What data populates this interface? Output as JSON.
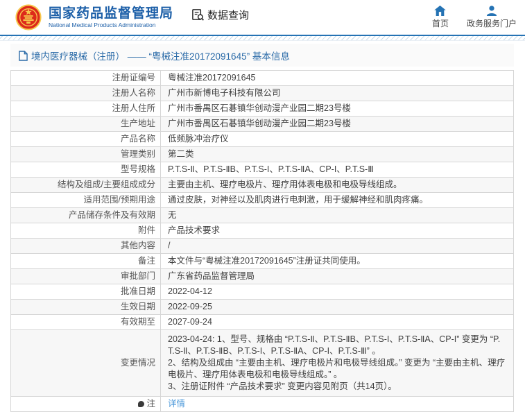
{
  "header": {
    "title": "国家药品监督管理局",
    "subtitle": "National Medical Products Administration",
    "data_query_label": "数据查询",
    "nav": [
      {
        "label": "首页",
        "icon": "home-icon"
      },
      {
        "label": "政务服务门户",
        "icon": "user-icon"
      }
    ]
  },
  "colors": {
    "brand_blue": "#1c5fa8",
    "icon_blue": "#2573b4",
    "link_blue": "#4a97d9",
    "emblem_red": "#dd2a1b",
    "emblem_gold": "#f7c84c",
    "stripe_gray": "#f7f7f7"
  },
  "breadcrumb": {
    "text": "境内医疗器械（注册） —— “粤械注准20172091645” 基本信息"
  },
  "table": {
    "rows": [
      {
        "label": "注册证编号",
        "value": "粤械注准20172091645"
      },
      {
        "label": "注册人名称",
        "value": "广州市新博电子科技有限公司"
      },
      {
        "label": "注册人住所",
        "value": "广州市番禺区石碁镇华创动漫产业园二期23号楼"
      },
      {
        "label": "生产地址",
        "value": "广州市番禺区石碁镇华创动漫产业园二期23号楼"
      },
      {
        "label": "产品名称",
        "value": "低频脉冲治疗仪"
      },
      {
        "label": "管理类别",
        "value": "第二类"
      },
      {
        "label": "型号规格",
        "value": "P.T.S-Ⅱ、P.T.S-ⅡB、P.T.S-I、P.T.S-ⅡA、CP-I、P.T.S-Ⅲ"
      },
      {
        "label": "结构及组成/主要组成成分",
        "value": "主要由主机、理疗电极片、理疗用体表电极和电极导线组成。"
      },
      {
        "label": "适用范围/预期用途",
        "value": "通过皮肤，对神经以及肌肉进行电刺激，用于缓解神经和肌肉疼痛。"
      },
      {
        "label": "产品储存条件及有效期",
        "value": "无"
      },
      {
        "label": "附件",
        "value": "产品技术要求"
      },
      {
        "label": "其他内容",
        "value": "/"
      },
      {
        "label": "备注",
        "value": "本文件与“粤械注准20172091645”注册证共同使用。"
      },
      {
        "label": "审批部门",
        "value": "广东省药品监督管理局"
      },
      {
        "label": "批准日期",
        "value": "2022-04-12"
      },
      {
        "label": "生效日期",
        "value": "2022-09-25"
      },
      {
        "label": "有效期至",
        "value": "2027-09-24"
      },
      {
        "label": "变更情况",
        "multiline": true,
        "value": "2023-04-24: 1、型号、规格由 “P.T.S-Ⅱ、P.T.S-ⅡB、P.T.S-I、P.T.S-ⅡA、CP-I” 变更为 “P.T.S-Ⅱ、P.T.S-ⅡB、P.T.S-I、P.T.S-ⅡA、CP-I、P.T.S-Ⅲ” 。\n2、结构及组成由 “主要由主机、理疗电极片和电极导线组成。” 变更为 “主要由主机、理疗电极片、理疗用体表电极和电极导线组成。” 。\n3、注册证附件 “产品技术要求” 变更内容见附页（共14页）。"
      },
      {
        "label": "注",
        "value": "详情",
        "link": true,
        "label_icon": "note-balloon-icon"
      }
    ]
  }
}
